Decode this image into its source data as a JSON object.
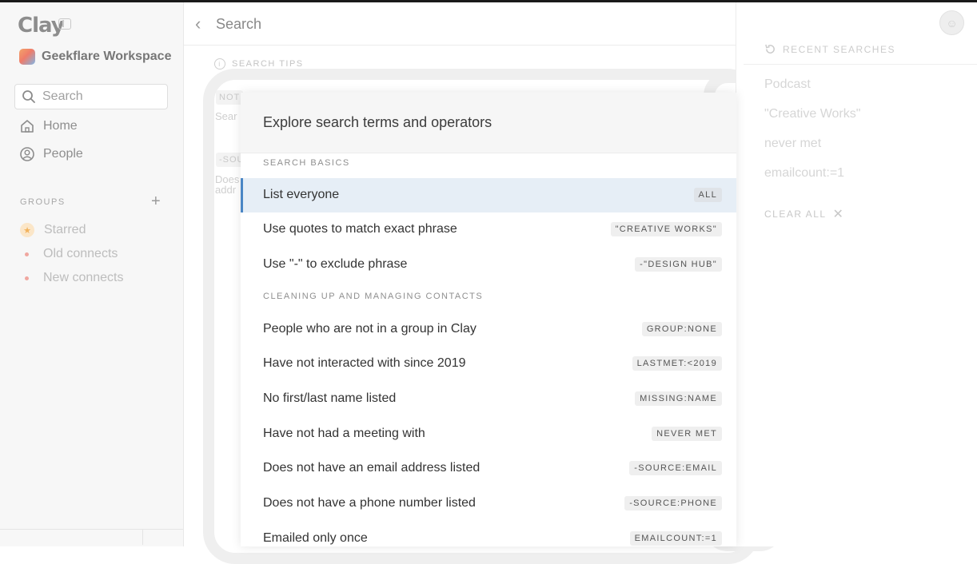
{
  "sidebar": {
    "logo": "Clay",
    "workspace_name": "Geekflare Workspace",
    "search_placeholder": "Search",
    "nav": [
      {
        "label": "Home",
        "icon": "home-icon"
      },
      {
        "label": "People",
        "icon": "person-circle-icon"
      }
    ],
    "groups_label": "GROUPS",
    "groups": [
      {
        "label": "Starred",
        "icon": "star-icon"
      },
      {
        "label": "Old connects",
        "icon": "dot-icon"
      },
      {
        "label": "New connects",
        "icon": "dot-icon"
      }
    ]
  },
  "main": {
    "title": "Search",
    "tips_label": "SEARCH TIPS",
    "fragments": {
      "chip1": "NOT",
      "text1": "Sear",
      "chip2": "-SOU",
      "text2": "Does",
      "text3": "addr"
    }
  },
  "right_panel": {
    "recent_label": "RECENT SEARCHES",
    "recent": [
      "Podcast",
      "\"Creative Works\"",
      "never met",
      "emailcount:=1"
    ],
    "clear_all": "CLEAR ALL"
  },
  "modal": {
    "title": "Explore search terms and operators",
    "sections": [
      {
        "label": "SEARCH BASICS",
        "rows": [
          {
            "label": "List everyone",
            "chip": "ALL",
            "selected": true
          },
          {
            "label": "Use quotes to match exact phrase",
            "chip": "\"CREATIVE WORKS\""
          },
          {
            "label": "Use \"-\" to exclude phrase",
            "chip": "-\"DESIGN HUB\""
          }
        ]
      },
      {
        "label": "CLEANING UP AND MANAGING CONTACTS",
        "rows": [
          {
            "label": "People who are not in a group in Clay",
            "chip": "GROUP:NONE"
          },
          {
            "label": "Have not interacted with since 2019",
            "chip": "LASTMET:<2019"
          },
          {
            "label": "No first/last name listed",
            "chip": "MISSING:NAME"
          },
          {
            "label": "Have not had a meeting with",
            "chip": "NEVER MET"
          },
          {
            "label": "Does not have an email address listed",
            "chip": "-SOURCE:EMAIL"
          },
          {
            "label": "Does not have a phone number listed",
            "chip": "-SOURCE:PHONE"
          },
          {
            "label": "Emailed only once",
            "chip": "EMAILCOUNT:=1"
          }
        ]
      }
    ]
  }
}
